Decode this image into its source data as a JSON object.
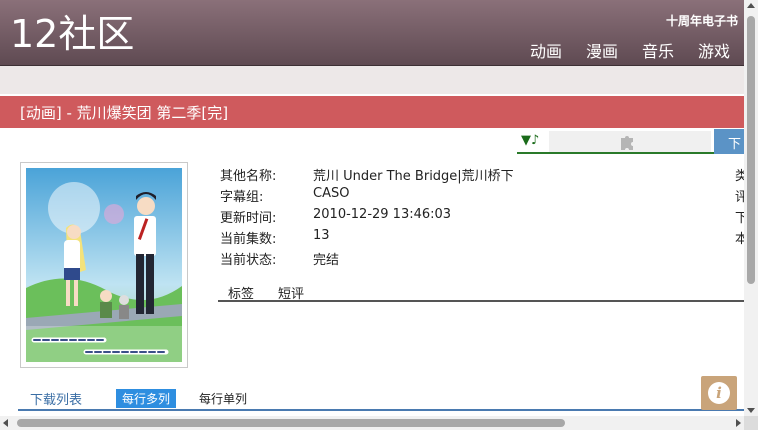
{
  "header": {
    "logo_text": "12社区",
    "tagline": "十周年电子书",
    "nav": [
      "动画",
      "漫画",
      "音乐",
      "游戏"
    ]
  },
  "page_title": "[动画] - 荒川爆笑团 第二季[完]",
  "player": {
    "note_icon": "▼♪",
    "plugin_icon": "puzzle-icon"
  },
  "download_button_label": "下",
  "info": {
    "rows": [
      {
        "key": "其他名称:",
        "value": "荒川 Under The Bridge|荒川桥下"
      },
      {
        "key": "字幕组:",
        "value": "CASO"
      },
      {
        "key": "更新时间:",
        "value": "2010-12-29 13:46:03"
      },
      {
        "key": "当前集数:",
        "value": "13"
      },
      {
        "key": "当前状态:",
        "value": "完结"
      }
    ],
    "right_column": [
      "类",
      "评",
      "下",
      "本"
    ]
  },
  "tabs": [
    "标签",
    "短评"
  ],
  "download_list": {
    "label": "下载列表",
    "multi": "每行多列",
    "single": "每行单列"
  },
  "colors": {
    "header": "#6e5861",
    "title_bar": "#cf5a5d",
    "accent_blue": "#2e8ee0",
    "info_button": "#c9a47a"
  }
}
